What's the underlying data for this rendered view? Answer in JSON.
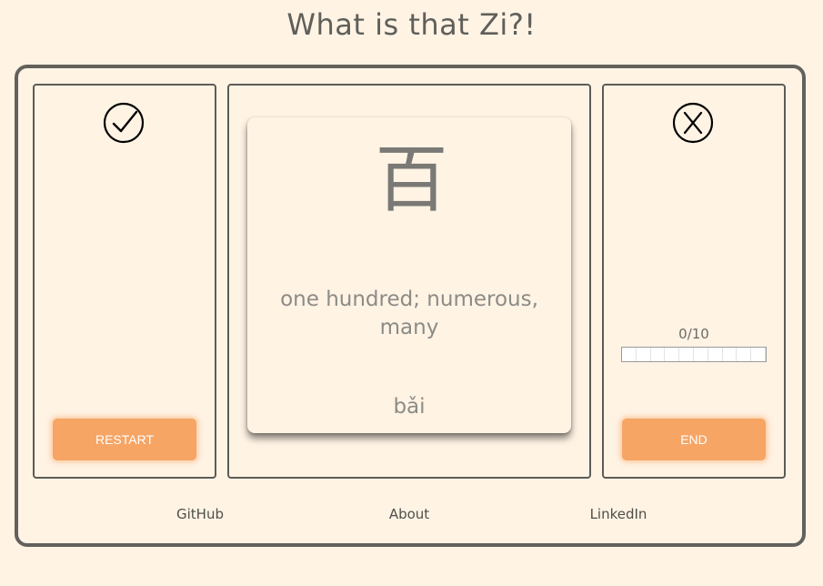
{
  "app": {
    "title": "What is that Zi?!"
  },
  "card": {
    "character": "百",
    "meaning": "one hundred; numerous, many",
    "pinyin": "bǎi"
  },
  "progress": {
    "text": "0/10",
    "current": 0,
    "total": 10
  },
  "buttons": {
    "restart": "RESTART",
    "end": "END"
  },
  "footer": {
    "github": "GitHub",
    "about": "About",
    "linkedin": "LinkedIn"
  },
  "icons": {
    "correct": "check-circle-icon",
    "wrong": "x-circle-icon"
  },
  "colors": {
    "accent": "#f6a564",
    "background": "#fff3e4",
    "border": "#62615c"
  }
}
